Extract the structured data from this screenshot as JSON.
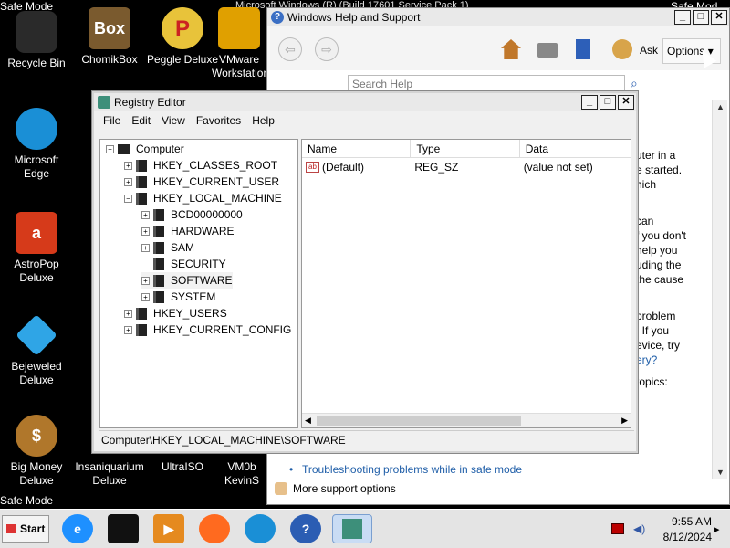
{
  "safe_mode_label": "Safe Mode",
  "safe_mode_label_fragment_top": "Microsoft Windows (R) (Build 17601 Service Pack 1)",
  "safe_mode_label_fragment_right": "Safe Mod",
  "desktop_icons": [
    {
      "label": "Recycle Bin",
      "icon": "recycle-bin-icon"
    },
    {
      "label": "ChomikBox",
      "icon": "chomikbox-icon"
    },
    {
      "label": "Peggle Deluxe",
      "icon": "peggle-icon"
    },
    {
      "label": "VMware Workstation",
      "icon": "vmware-icon"
    },
    {
      "label": "Microsoft Edge",
      "icon": "edge-icon"
    },
    {
      "label": "AstroPop Deluxe",
      "icon": "astropop-icon"
    },
    {
      "label": "Bejeweled Deluxe",
      "icon": "bejeweled-icon"
    },
    {
      "label": "Big Money Deluxe",
      "icon": "big-money-icon"
    },
    {
      "label": "Insaniquarium Deluxe",
      "icon": "insaniquarium-icon"
    },
    {
      "label": "UltraISO",
      "icon": "ultraiso-icon"
    },
    {
      "label": "VM0b KevinS",
      "icon": "vm-icon"
    }
  ],
  "help_window": {
    "title": "Windows Help and Support",
    "ask_label": "Ask",
    "options_label": "Options",
    "search_placeholder": "Search Help",
    "body_fragments": [
      "uter in a",
      "e started.",
      "hich",
      "",
      "can",
      "f you don't",
      "help you",
      "uding the",
      "the cause",
      "",
      "problem",
      ". If you",
      "evice, try",
      "ery?",
      "",
      "topics:"
    ],
    "troubleshooting_link": "Troubleshooting problems while in safe mode",
    "more_support": "More support options"
  },
  "registry_editor": {
    "title": "Registry Editor",
    "menu": [
      "File",
      "Edit",
      "View",
      "Favorites",
      "Help"
    ],
    "tree": [
      {
        "label": "Computer",
        "level": 0,
        "expander": "-",
        "type": "computer"
      },
      {
        "label": "HKEY_CLASSES_ROOT",
        "level": 1,
        "expander": "+"
      },
      {
        "label": "HKEY_CURRENT_USER",
        "level": 1,
        "expander": "+"
      },
      {
        "label": "HKEY_LOCAL_MACHINE",
        "level": 1,
        "expander": "-"
      },
      {
        "label": "BCD00000000",
        "level": 2,
        "expander": "+"
      },
      {
        "label": "HARDWARE",
        "level": 2,
        "expander": "+"
      },
      {
        "label": "SAM",
        "level": 2,
        "expander": "+"
      },
      {
        "label": "SECURITY",
        "level": 2,
        "expander": ""
      },
      {
        "label": "SOFTWARE",
        "level": 2,
        "expander": "+",
        "selected": true
      },
      {
        "label": "SYSTEM",
        "level": 2,
        "expander": "+"
      },
      {
        "label": "HKEY_USERS",
        "level": 1,
        "expander": "+"
      },
      {
        "label": "HKEY_CURRENT_CONFIG",
        "level": 1,
        "expander": "+"
      }
    ],
    "columns": [
      "Name",
      "Type",
      "Data"
    ],
    "values": [
      {
        "name": "(Default)",
        "type": "REG_SZ",
        "data": "(value not set)",
        "icon": "ab"
      }
    ],
    "status": "Computer\\HKEY_LOCAL_MACHINE\\SOFTWARE"
  },
  "taskbar": {
    "start_label": "Start",
    "time": "9:55 AM",
    "date": "8/12/2024",
    "apps": [
      {
        "name": "internet-explorer-icon",
        "glyph": "e",
        "color": "#1e90ff"
      },
      {
        "name": "drive-icon",
        "glyph": "",
        "color": "#111111"
      },
      {
        "name": "media-player-icon",
        "glyph": "▶",
        "color": "#e58a1f"
      },
      {
        "name": "firefox-icon",
        "glyph": "",
        "color": "#ff6a1f"
      },
      {
        "name": "edge-icon",
        "glyph": "",
        "color": "#1a8fd6"
      },
      {
        "name": "help-icon",
        "glyph": "?",
        "color": "#2b5db3"
      },
      {
        "name": "regedit-icon",
        "glyph": "",
        "color": "#3d8f7a"
      }
    ]
  },
  "colors": {
    "desktop_bg": "#000000",
    "link": "#1f5ea8",
    "taskbar": "#e4e4e4"
  }
}
